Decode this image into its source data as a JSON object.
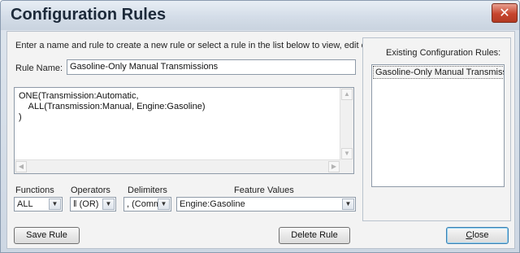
{
  "window": {
    "title": "Configuration Rules",
    "close_glyph": "✕"
  },
  "instructions": "Enter a name and rule to create a new rule or select a rule in the list below to view, edit or delete it.",
  "rule_name": {
    "label": "Rule Name:",
    "value": "Gasoline-Only Manual Transmissions"
  },
  "rule_text": "ONE(Transmission:Automatic,\n    ALL(Transmission:Manual, Engine:Gasoline)\n)",
  "existing": {
    "label": "Existing Configuration Rules:",
    "items": [
      "Gasoline-Only Manual Transmissions"
    ]
  },
  "pickers": {
    "functions": {
      "label": "Functions",
      "selected": "ALL"
    },
    "operators": {
      "label": "Operators",
      "selected": "‖ (OR)"
    },
    "delimiters": {
      "label": "Delimiters",
      "selected": ", (Comma)"
    },
    "feature_values": {
      "label": "Feature Values",
      "selected": "Engine:Gasoline"
    }
  },
  "buttons": {
    "save": "Save Rule",
    "delete": "Delete Rule",
    "close_first": "C",
    "close_rest": "lose"
  },
  "icons": {
    "dropdown": "chevron-down-icon",
    "scroll_up": "scroll-up-arrow-icon",
    "scroll_down": "scroll-down-arrow-icon",
    "scroll_left": "scroll-left-arrow-icon",
    "scroll_right": "scroll-right-arrow-icon",
    "close": "close-icon"
  },
  "colors": {
    "close_button": "#c6452e",
    "title_text": "#1d2a3a",
    "focus_border": "#3c7fb1"
  }
}
